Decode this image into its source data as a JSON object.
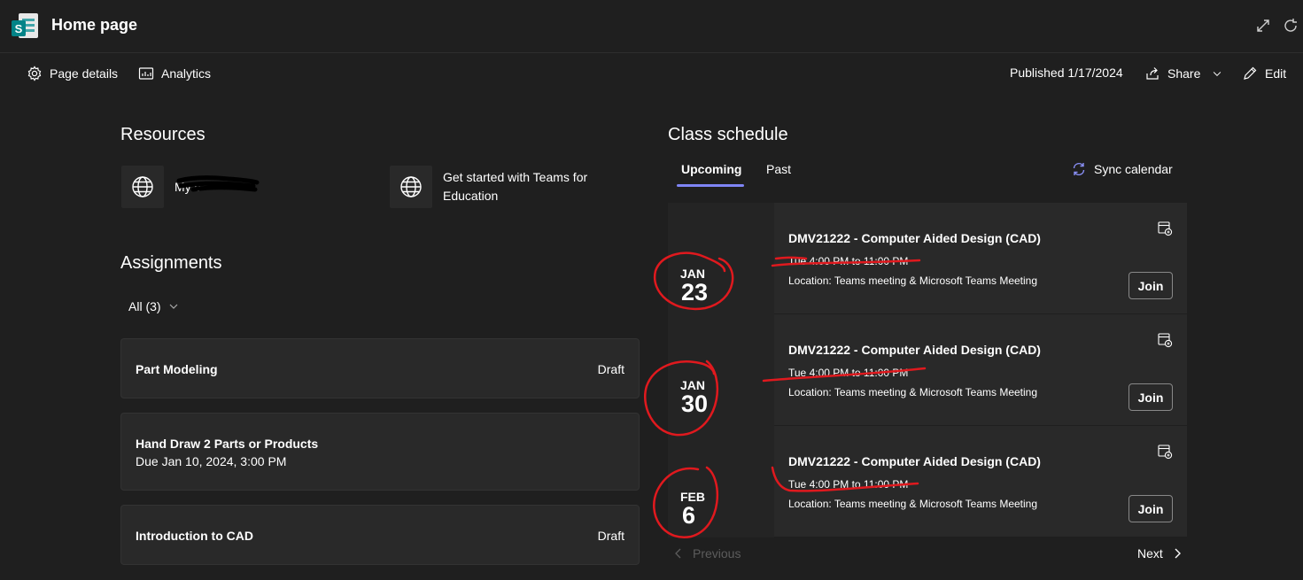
{
  "header": {
    "title": "Home page"
  },
  "commandbar": {
    "page_details": "Page details",
    "analytics": "Analytics",
    "published": "Published 1/17/2024",
    "share": "Share",
    "edit": "Edit"
  },
  "resources": {
    "title": "Resources",
    "items": [
      {
        "label": "My s",
        "icon": "globe-icon"
      },
      {
        "label": "Get started with Teams for Education",
        "icon": "globe-icon"
      }
    ]
  },
  "assignments": {
    "title": "Assignments",
    "filter": "All (3)",
    "items": [
      {
        "title": "Part Modeling",
        "status": "Draft",
        "due": ""
      },
      {
        "title": "Hand Draw 2 Parts or Products",
        "status": "",
        "due": "Due Jan 10, 2024, 3:00 PM"
      },
      {
        "title": "Introduction to CAD",
        "status": "Draft",
        "due": ""
      }
    ]
  },
  "schedule": {
    "title": "Class schedule",
    "tabs": [
      "Upcoming",
      "Past"
    ],
    "sync": "Sync calendar",
    "events": [
      {
        "month": "JAN",
        "day": "23",
        "title": "DMV21222 - Computer Aided Design (CAD)",
        "time": "Tue 4:00 PM to 11:00 PM",
        "location": "Location: Teams meeting & Microsoft Teams Meeting",
        "join": "Join"
      },
      {
        "month": "JAN",
        "day": "30",
        "title": "DMV21222 - Computer Aided Design (CAD)",
        "time": "Tue 4:00 PM to 11:00 PM",
        "location": "Location: Teams meeting & Microsoft Teams Meeting",
        "join": "Join"
      },
      {
        "month": "FEB",
        "day": "6",
        "title": "DMV21222 - Computer Aided Design (CAD)",
        "time": "Tue 4:00 PM to 11:00 PM",
        "location": "Location: Teams meeting & Microsoft Teams Meeting",
        "join": "Join"
      }
    ],
    "previous": "Previous",
    "next": "Next"
  },
  "colors": {
    "background": "#1f1f1f",
    "card": "#292929",
    "accent": "#7f85f5",
    "annotation": "#e0191e",
    "sharepoint": "#038387"
  }
}
